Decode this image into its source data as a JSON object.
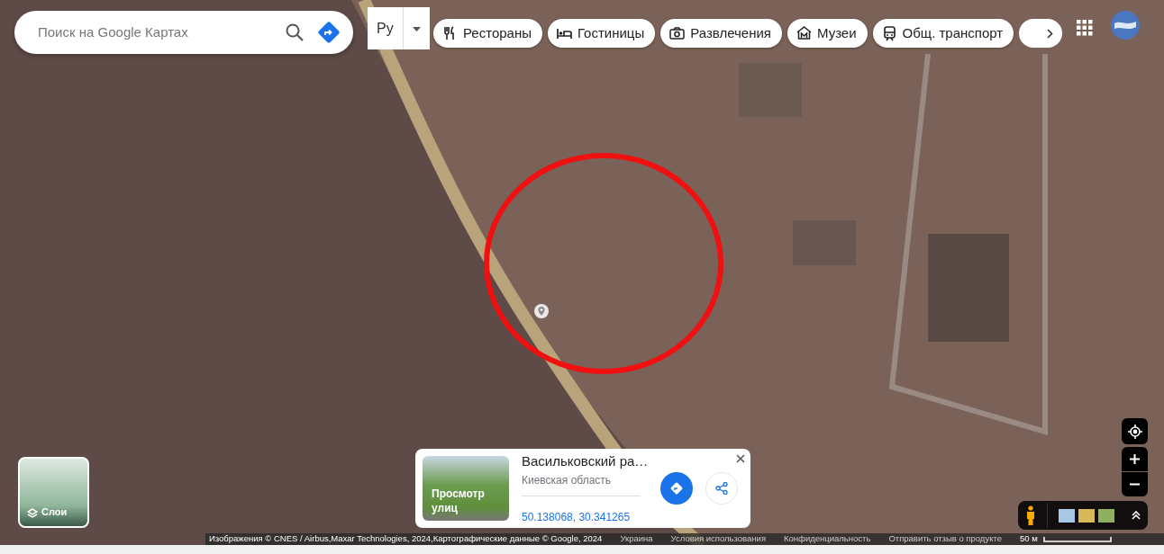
{
  "search": {
    "placeholder": "Поиск на Google Картах"
  },
  "map_type": {
    "label": "Ру"
  },
  "categories": [
    {
      "label": "Рестораны",
      "kind": "restaurant"
    },
    {
      "label": "Гостиницы",
      "kind": "hotel"
    },
    {
      "label": "Развлечения",
      "kind": "camera"
    },
    {
      "label": "Музеи",
      "kind": "museum"
    },
    {
      "label": "Общ. транспорт",
      "kind": "transit"
    }
  ],
  "place_card": {
    "street_view_label": "Просмотр улиц",
    "title": "Васильковский ра…",
    "subtitle": "Киевская область",
    "coordinates": "50.138068, 30.341265"
  },
  "layers": {
    "label": "Слои"
  },
  "footer": {
    "attribution": "Изображения © CNES / Airbus,Maxar Technologies, 2024,Картографические данные © Google, 2024",
    "links": [
      "Украина",
      "Условия использования",
      "Конфиденциальность",
      "Отправить отзыв о продукте"
    ],
    "scale": "50 м"
  }
}
